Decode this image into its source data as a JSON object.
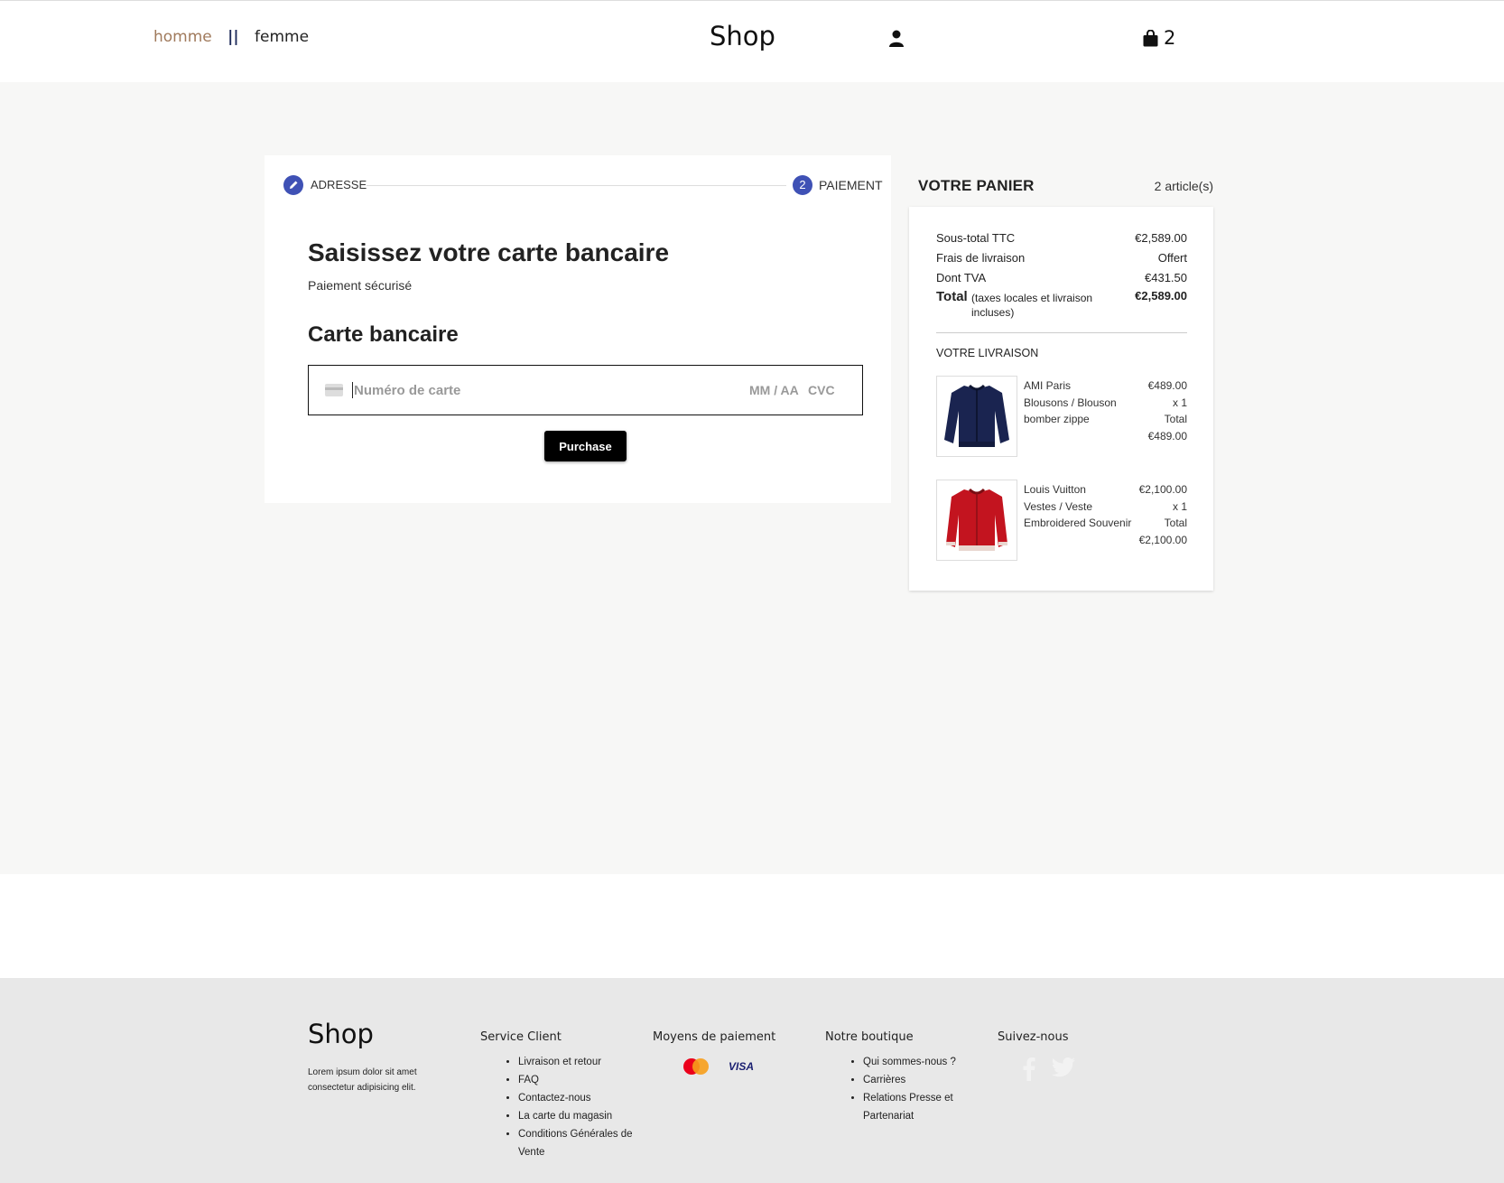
{
  "header": {
    "nav": {
      "homme": "homme",
      "separator": "||",
      "femme": "femme"
    },
    "brand": "Shop",
    "cart_count": "2"
  },
  "checkout": {
    "steps": [
      {
        "label": "ADRESSE",
        "icon": "pencil-icon",
        "marker": ""
      },
      {
        "label": "PAIEMENT",
        "icon": "",
        "marker": "2"
      }
    ],
    "title": "Saisissez votre carte bancaire",
    "subtitle": "Paiement sécurisé",
    "section_title": "Carte bancaire",
    "card_number_placeholder": "Numéro de carte",
    "expiry_placeholder": "MM / AA",
    "cvc_placeholder": "CVC",
    "purchase_label": "Purchase"
  },
  "cart": {
    "title": "VOTRE PANIER",
    "count_label": "2 article(s)",
    "rows": [
      {
        "label": "Sous-total TTC",
        "value": "€2,589.00"
      },
      {
        "label": "Frais de livraison",
        "value": "Offert"
      },
      {
        "label": "Dont TVA",
        "value": "€431.50"
      }
    ],
    "total": {
      "label": "Total",
      "note": "(taxes locales et livraison incluses)",
      "value": "€2,589.00"
    },
    "delivery_title": "VOTRE LIVRAISON",
    "items": [
      {
        "brand": "AMI Paris",
        "category": "Blousons / Blouson",
        "name": "bomber zippe",
        "unit_price": "€489.00",
        "qty": "x 1",
        "total_label": "Total",
        "total": "€489.00",
        "image": "navy-bomber-jacket"
      },
      {
        "brand": "Louis Vuitton",
        "category": "Vestes / Veste",
        "name": "Embroidered Souvenir",
        "unit_price": "€2,100.00",
        "qty": "x 1",
        "total_label": "Total",
        "total": "€2,100.00",
        "image": "red-souvenir-jacket"
      }
    ]
  },
  "footer": {
    "brand": "Shop",
    "text": "Lorem ipsum dolor sit amet consectetur adipisicing elit.",
    "columns": {
      "service": {
        "title": "Service Client",
        "links": [
          "Livraison et retour",
          "FAQ",
          "Contactez-nous",
          "La carte du magasin",
          "Conditions Générales de Vente"
        ]
      },
      "payment": {
        "title": "Moyens de paiement",
        "icons": [
          "mastercard-icon",
          "visa-icon"
        ],
        "visa_text": "VISA"
      },
      "boutique": {
        "title": "Notre boutique",
        "links": [
          "Qui sommes-nous ?",
          "Carrières",
          "Relations Presse et Partenariat"
        ]
      },
      "social": {
        "title": "Suivez-nous",
        "icons": [
          "facebook-icon",
          "twitter-icon"
        ]
      }
    }
  },
  "colors": {
    "accent": "#3f51b5",
    "nav_homme": "#a07a5c",
    "main_bg": "#f7f7f6",
    "footer_bg": "#e8e8e8"
  }
}
